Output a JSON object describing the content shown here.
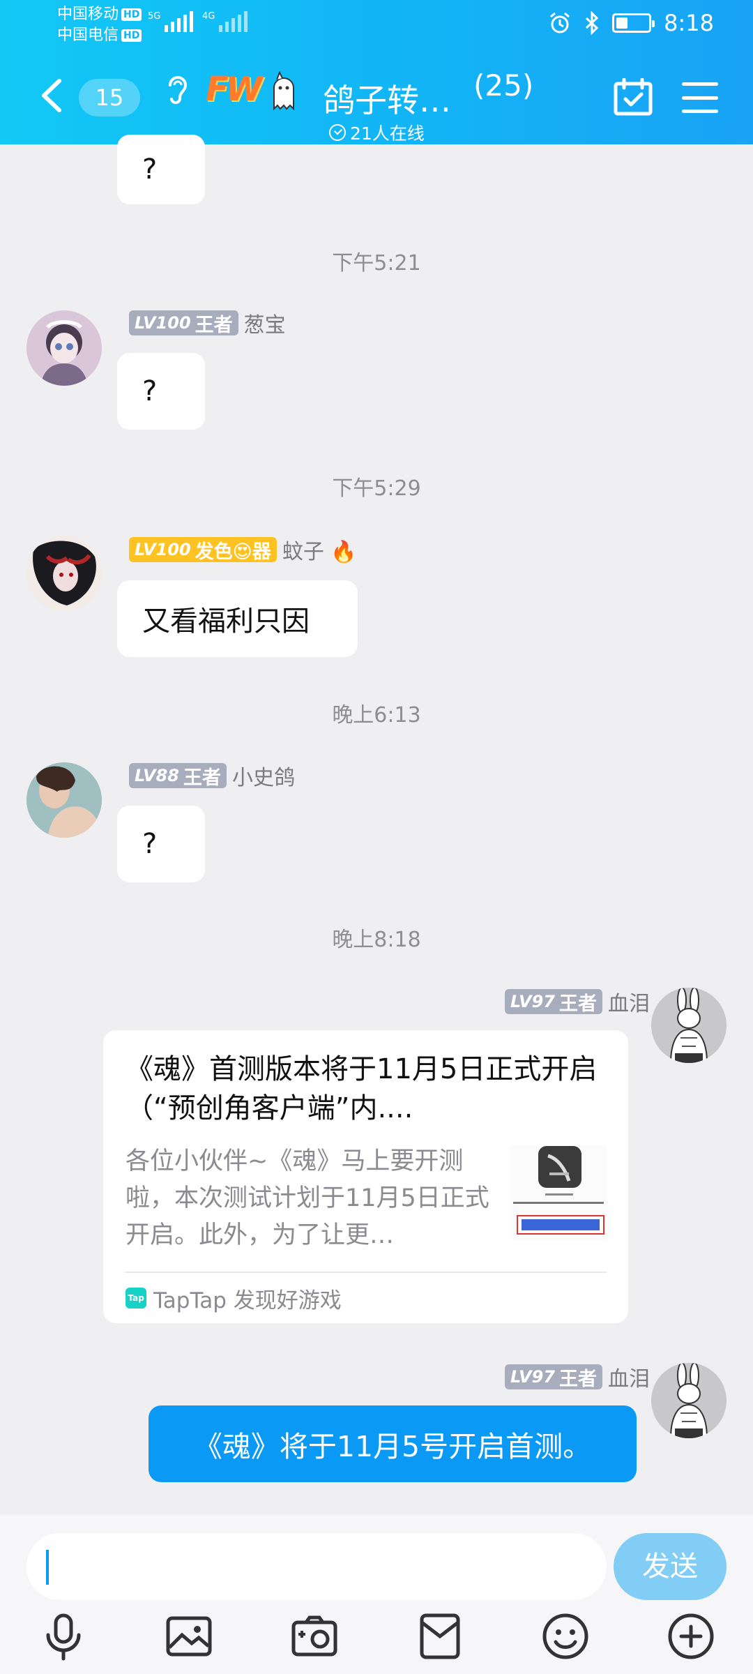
{
  "status": {
    "carrier1": "中国移动",
    "carrier2": "中国电信",
    "hd": "HD",
    "net1": "5G",
    "net2": "4G",
    "time": "8:18"
  },
  "header": {
    "unread": "15",
    "logo": "FW",
    "title": "鸽子转…",
    "member_count": "(25)",
    "online": "21人在线"
  },
  "messages": {
    "partial_q": "?",
    "t1": "下午5:21",
    "m1": {
      "lv": "LV100",
      "rank": "王者",
      "name": "葱宝",
      "text": "?"
    },
    "t2": "下午5:29",
    "m2": {
      "lv": "LV100",
      "rank": "发色😍器",
      "name": "蚊子 🔥",
      "text": "又看福利只因"
    },
    "t3": "晚上6:13",
    "m3": {
      "lv": "LV88",
      "rank": "王者",
      "name": "小史鸽",
      "text": "?"
    },
    "t4": "晚上8:18",
    "m4": {
      "lv": "LV97",
      "rank": "王者",
      "name": "血泪",
      "card_title": "《魂》首测版本将于11月5日正式开启（“预创角客户端”内....",
      "card_desc": "各位小伙伴~《魂》马上要开测啦，本次测试计划于11月5日正式开启。此外，为了让更…",
      "card_source": "TapTap 发现好游戏",
      "tap_icon": "Tap"
    },
    "m5": {
      "lv": "LV97",
      "rank": "王者",
      "name": "血泪",
      "text": "《魂》将于11月5号开启首测。"
    }
  },
  "input": {
    "send": "发送"
  },
  "colors": {
    "header": "#12b6f6",
    "bubble_blue": "#0a99f5",
    "send_disabled": "#82cdf6",
    "level_badge": "#a8adbd",
    "level_gold": "#ffc223"
  },
  "icons": [
    "back-icon",
    "ear-icon",
    "ghost-icon",
    "calendar-icon",
    "menu-icon",
    "mic-icon",
    "image-icon",
    "camera-icon",
    "red-packet-icon",
    "emoji-icon",
    "plus-icon"
  ]
}
